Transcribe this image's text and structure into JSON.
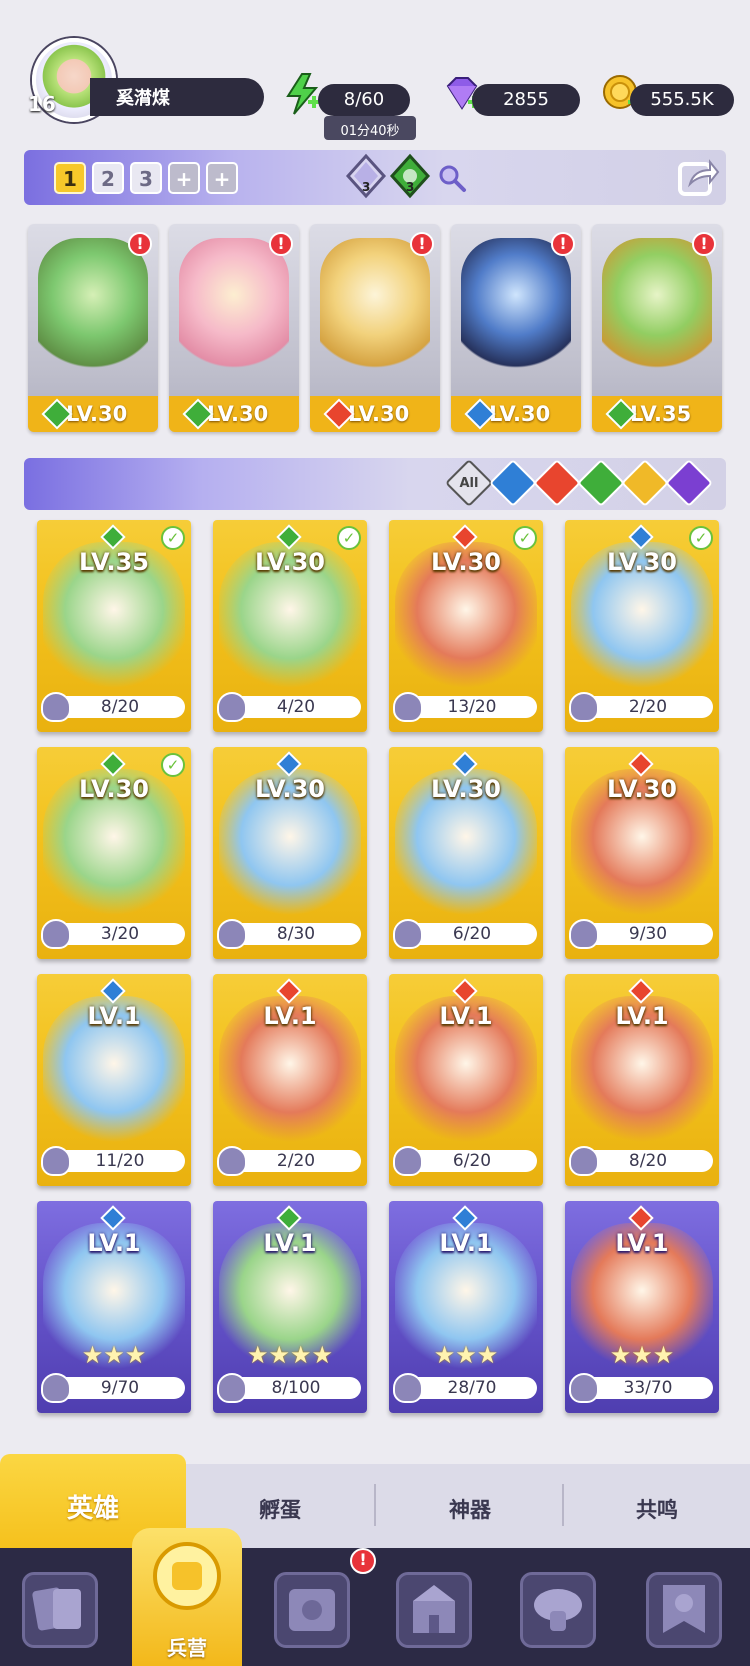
{
  "player": {
    "level": "16",
    "name": "奚潸煤"
  },
  "resources": {
    "energy": "8/60",
    "timer": "01分40秒",
    "gems": "2855",
    "gold": "555.5K"
  },
  "squad": {
    "slots": [
      "1",
      "2",
      "3",
      "+",
      "+"
    ],
    "badge_counts": [
      "3",
      "3"
    ],
    "members": [
      {
        "level": "LV.30",
        "element": "nature",
        "alert": "!"
      },
      {
        "level": "LV.30",
        "element": "nature",
        "alert": "!"
      },
      {
        "level": "LV.30",
        "element": "fire",
        "alert": "!"
      },
      {
        "level": "LV.30",
        "element": "water",
        "alert": "!"
      },
      {
        "level": "LV.35",
        "element": "nature",
        "alert": "!"
      }
    ]
  },
  "filters": [
    "All",
    "water",
    "fire",
    "nature",
    "light",
    "dark"
  ],
  "heroes": [
    {
      "level": "LV.35",
      "progress": "8/20",
      "element": "nature",
      "checked": true,
      "rarity": "gold"
    },
    {
      "level": "LV.30",
      "progress": "4/20",
      "element": "nature",
      "checked": true,
      "rarity": "gold"
    },
    {
      "level": "LV.30",
      "progress": "13/20",
      "element": "fire",
      "checked": true,
      "rarity": "gold"
    },
    {
      "level": "LV.30",
      "progress": "2/20",
      "element": "water",
      "checked": true,
      "rarity": "gold"
    },
    {
      "level": "LV.30",
      "progress": "3/20",
      "element": "nature",
      "checked": true,
      "rarity": "gold"
    },
    {
      "level": "LV.30",
      "progress": "8/30",
      "element": "water",
      "checked": false,
      "rarity": "gold"
    },
    {
      "level": "LV.30",
      "progress": "6/20",
      "element": "water",
      "checked": false,
      "rarity": "gold"
    },
    {
      "level": "LV.30",
      "progress": "9/30",
      "element": "fire",
      "checked": false,
      "rarity": "gold"
    },
    {
      "level": "LV.1",
      "progress": "11/20",
      "element": "water",
      "checked": false,
      "rarity": "gold"
    },
    {
      "level": "LV.1",
      "progress": "2/20",
      "element": "fire",
      "checked": false,
      "rarity": "gold"
    },
    {
      "level": "LV.1",
      "progress": "6/20",
      "element": "fire",
      "checked": false,
      "rarity": "gold"
    },
    {
      "level": "LV.1",
      "progress": "8/20",
      "element": "fire",
      "checked": false,
      "rarity": "gold"
    },
    {
      "level": "LV.1",
      "progress": "9/70",
      "element": "water",
      "checked": false,
      "rarity": "purple",
      "stars": "★★★"
    },
    {
      "level": "LV.1",
      "progress": "8/100",
      "element": "nature",
      "checked": false,
      "rarity": "purple",
      "stars": "★★★★"
    },
    {
      "level": "LV.1",
      "progress": "28/70",
      "element": "water",
      "checked": false,
      "rarity": "purple",
      "stars": "★★★"
    },
    {
      "level": "LV.1",
      "progress": "33/70",
      "element": "fire",
      "checked": false,
      "rarity": "purple",
      "stars": "★★★"
    }
  ],
  "tabs": [
    "英雄",
    "孵蛋",
    "神器",
    "共鸣"
  ],
  "nav": {
    "active_label": "兵营",
    "alert": "!"
  },
  "colors": {
    "nature": "#3fae3a",
    "fire": "#e8452e",
    "water": "#2f7fd6",
    "light": "#f0b928",
    "dark": "#7b3fd1",
    "gold": "#f3c21e",
    "purple": "#6452c9"
  }
}
